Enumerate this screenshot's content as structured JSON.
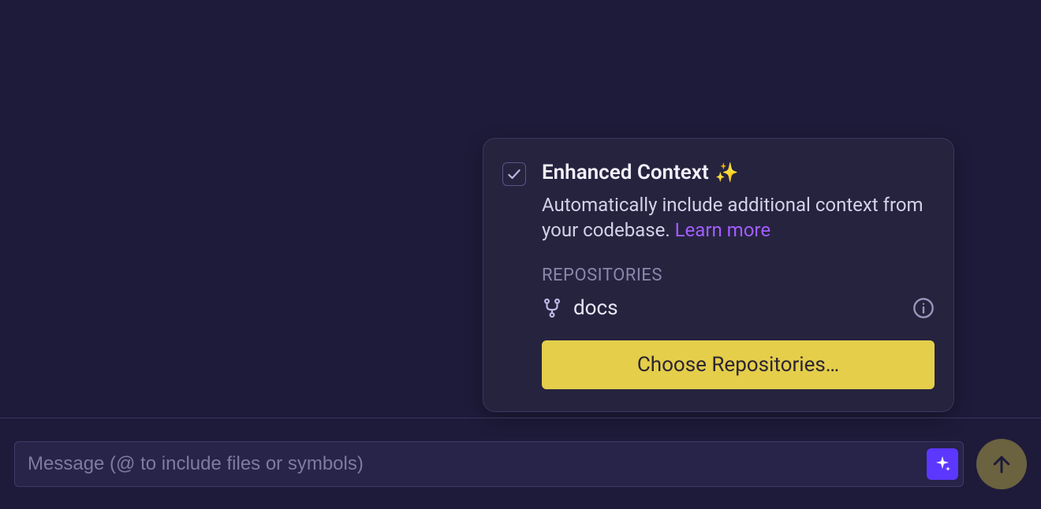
{
  "popover": {
    "title": "Enhanced Context",
    "title_emoji": "✨",
    "description": "Automatically include additional context from your codebase.",
    "learn_more": "Learn more",
    "section_label": "REPOSITORIES",
    "repo_name": "docs",
    "choose_button": "Choose Repositories…",
    "checked": true
  },
  "input": {
    "placeholder": "Message (@ to include files or symbols)"
  }
}
